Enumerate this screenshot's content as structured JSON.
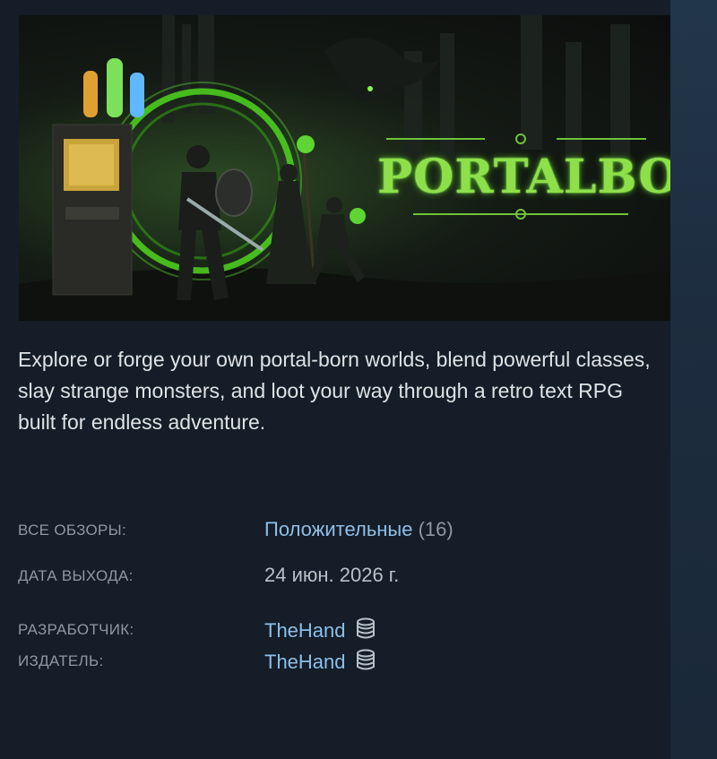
{
  "game": {
    "logo_text": "PORTALBORN",
    "description": "Explore or forge your own portal-born worlds, blend powerful classes, slay strange monsters, and loot your way through a retro text RPG built for endless adventure."
  },
  "details": {
    "reviews_label": "ВСЕ ОБЗОРЫ:",
    "reviews_summary": "Положительные",
    "reviews_count": "(16)",
    "release_label": "ДАТА ВЫХОДА:",
    "release_date": "24 июн. 2026 г.",
    "developer_label": "РАЗРАБОТЧИК:",
    "developer": "TheHand",
    "publisher_label": "ИЗДАТЕЛЬ:",
    "publisher": "TheHand"
  },
  "colors": {
    "background": "#1b2838",
    "link": "#8fbfe6",
    "logo_green": "#8ee04a"
  },
  "icons": [
    "coin-stack-icon"
  ]
}
